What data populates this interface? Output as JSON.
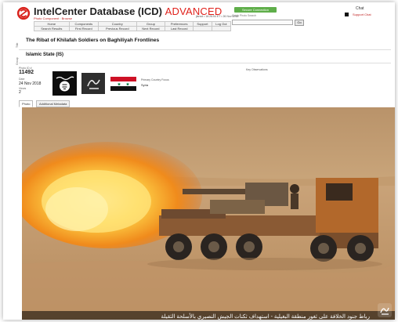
{
  "header": {
    "title": "IntelCenter Database (ICD)",
    "title_accent": "ADVANCED",
    "subtitle": "Photo Component : Browse",
    "session": "jlansd • 16:26:54 ET • 26 Nov 2018",
    "secure_button": "Secure Connection",
    "search_label": "Quick Photo Search",
    "search_value": "",
    "go_label": "Go",
    "chat_label": "Chat",
    "chat_support": "Support Chat"
  },
  "nav": {
    "row1": [
      "Home",
      "Components",
      "Country",
      "Group",
      "Preferences",
      "Support",
      "Log Out"
    ],
    "row2": [
      "Search Results",
      "First Record",
      "Previous Record",
      "Next Record",
      "Last Record"
    ]
  },
  "record": {
    "side_title": "Title",
    "title": "The Ribat of Khilafah Soldiers on Baghiliyah Frontlines",
    "side_group": "Group",
    "group": "Islamic State (IS)",
    "photo_id_label": "Photo ID #",
    "photo_id": "11492",
    "date_label": "Date",
    "date": "24 Nov 2018",
    "views_label": "Views",
    "views": "2",
    "country_label": "Primary Country Focus",
    "country": "Syria",
    "key_obs_label": "Key Observations"
  },
  "tabs": [
    "Photo",
    "Additional Metadata"
  ],
  "photo": {
    "caption": "رباط جنود الخلافة على ثغور منطقة البغيلية - استهداف ثكنات الجيش النصيري بالأسلحة الثقيلة"
  },
  "icons": [
    "logo-icon",
    "flag-islamic-state-icon",
    "amaq-logo-icon",
    "flag-syria-icon",
    "watermark-icon"
  ],
  "colors": {
    "accent": "#e0211b",
    "secure": "#5fae4a"
  }
}
